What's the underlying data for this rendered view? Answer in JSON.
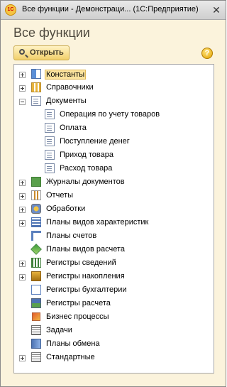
{
  "window": {
    "title": "Все функции - Демонстраци... (1С:Предприятие)",
    "app_icon": "1C",
    "close_glyph": "✕"
  },
  "panel": {
    "heading": "Все функции",
    "open_button_label": "Открыть",
    "help_glyph": "?"
  },
  "tree": [
    {
      "label": "Константы",
      "expander": "plus",
      "icon": "constants-icon",
      "selected": true
    },
    {
      "label": "Справочники",
      "expander": "plus",
      "icon": "catalogs-icon"
    },
    {
      "label": "Документы",
      "expander": "minus",
      "icon": "documents-icon"
    },
    {
      "label": "Операция по учету товаров",
      "child": true,
      "icon": "document-icon"
    },
    {
      "label": "Оплата",
      "child": true,
      "icon": "document-icon"
    },
    {
      "label": "Поступление денег",
      "child": true,
      "icon": "document-icon"
    },
    {
      "label": "Приход товара",
      "child": true,
      "icon": "document-icon"
    },
    {
      "label": "Расход товара",
      "child": true,
      "icon": "document-icon"
    },
    {
      "label": "Журналы документов",
      "expander": "plus",
      "icon": "journals-icon"
    },
    {
      "label": "Отчеты",
      "expander": "plus",
      "icon": "reports-icon"
    },
    {
      "label": "Обработки",
      "expander": "plus",
      "icon": "processing-icon"
    },
    {
      "label": "Планы видов характеристик",
      "expander": "plus",
      "icon": "characteristics-icon"
    },
    {
      "label": "Планы счетов",
      "icon": "chart-of-accounts-icon"
    },
    {
      "label": "Планы видов расчета",
      "icon": "calculation-types-icon"
    },
    {
      "label": "Регистры сведений",
      "expander": "plus",
      "icon": "info-registers-icon"
    },
    {
      "label": "Регистры накопления",
      "expander": "plus",
      "icon": "accumulation-registers-icon"
    },
    {
      "label": "Регистры бухгалтерии",
      "icon": "accounting-registers-icon"
    },
    {
      "label": "Регистры расчета",
      "icon": "calculation-registers-icon"
    },
    {
      "label": "Бизнес процессы",
      "icon": "business-processes-icon"
    },
    {
      "label": "Задачи",
      "icon": "tasks-icon"
    },
    {
      "label": "Планы обмена",
      "icon": "exchange-plans-icon"
    },
    {
      "label": "Стандартные",
      "expander": "plus",
      "icon": "standard-icon"
    }
  ]
}
